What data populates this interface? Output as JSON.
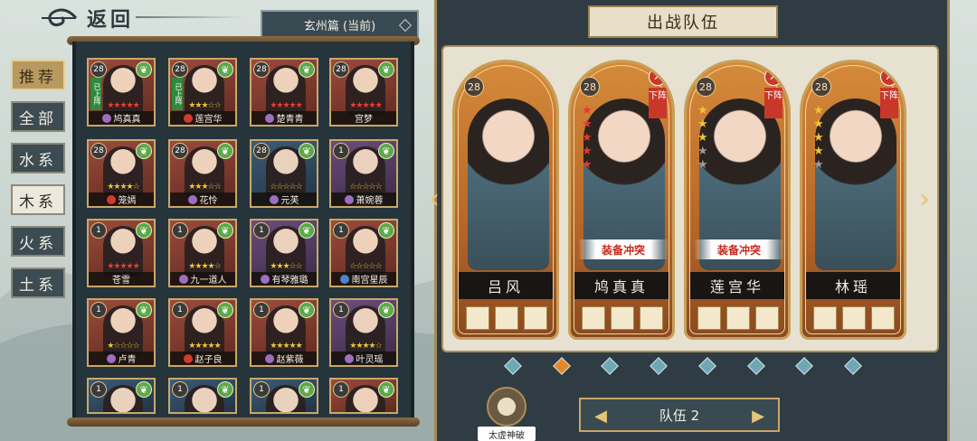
{
  "header": {
    "back_label": "返回",
    "chapter": "玄州篇 (当前)"
  },
  "filters": [
    "推荐",
    "全部",
    "水系",
    "木系",
    "火系",
    "土系"
  ],
  "roster": [
    {
      "name": "鸠真真",
      "level": "28",
      "stars": "★★★★★",
      "star_color": "red",
      "frame": "red",
      "badge": "已上阵",
      "icon": "purple"
    },
    {
      "name": "莲宫华",
      "level": "28",
      "stars": "★★★☆☆",
      "star_color": "gold",
      "frame": "red",
      "badge": "已上阵",
      "icon": "red"
    },
    {
      "name": "楚青青",
      "level": "28",
      "stars": "★★★★★",
      "star_color": "red",
      "frame": "red",
      "badge": "",
      "icon": "purple"
    },
    {
      "name": "宫梦",
      "level": "28",
      "stars": "★★★★★",
      "star_color": "red",
      "frame": "red",
      "badge": "",
      "icon": ""
    },
    {
      "name": "笼嫣",
      "level": "28",
      "stars": "★★★★☆",
      "star_color": "gold",
      "frame": "red",
      "badge": "",
      "icon": "red"
    },
    {
      "name": "花怜",
      "level": "28",
      "stars": "★★★☆☆",
      "star_color": "gold",
      "frame": "red",
      "badge": "",
      "icon": "purple"
    },
    {
      "name": "元芙",
      "level": "28",
      "stars": "☆☆☆☆☆",
      "star_color": "gold",
      "frame": "blue",
      "badge": "",
      "icon": "purple"
    },
    {
      "name": "萧婉蓉",
      "level": "1",
      "stars": "☆☆☆☆☆",
      "star_color": "gold",
      "frame": "purple",
      "badge": "",
      "icon": "purple"
    },
    {
      "name": "苍雪",
      "level": "1",
      "stars": "★★★★★",
      "star_color": "red",
      "frame": "red",
      "badge": "",
      "icon": ""
    },
    {
      "name": "九一道人",
      "level": "1",
      "stars": "★★★★☆",
      "star_color": "gold",
      "frame": "red",
      "badge": "",
      "icon": "purple"
    },
    {
      "name": "有琴雅璐",
      "level": "1",
      "stars": "★★★☆☆",
      "star_color": "gold",
      "frame": "purple",
      "badge": "",
      "icon": "purple"
    },
    {
      "name": "南宫星辰",
      "level": "1",
      "stars": "☆☆☆☆☆",
      "star_color": "gold",
      "frame": "red",
      "badge": "",
      "icon": "blue"
    },
    {
      "name": "卢青",
      "level": "1",
      "stars": "★☆☆☆☆",
      "star_color": "gold",
      "frame": "red",
      "badge": "",
      "icon": "purple"
    },
    {
      "name": "赵子良",
      "level": "1",
      "stars": "★★★★★",
      "star_color": "gold",
      "frame": "red",
      "badge": "",
      "icon": "red"
    },
    {
      "name": "赵紫薇",
      "level": "1",
      "stars": "★★★★★",
      "star_color": "gold",
      "frame": "red",
      "badge": "",
      "icon": "purple"
    },
    {
      "name": "叶灵瑶",
      "level": "1",
      "stars": "★★★★☆",
      "star_color": "gold",
      "frame": "purple",
      "badge": "",
      "icon": "purple"
    },
    {
      "name": "",
      "level": "1",
      "stars": "",
      "star_color": "gold",
      "frame": "blue",
      "badge": "",
      "icon": ""
    },
    {
      "name": "",
      "level": "1",
      "stars": "",
      "star_color": "gold",
      "frame": "blue",
      "badge": "",
      "icon": ""
    },
    {
      "name": "",
      "level": "1",
      "stars": "",
      "star_color": "gold",
      "frame": "blue",
      "badge": "",
      "icon": ""
    },
    {
      "name": "",
      "level": "1",
      "stars": "",
      "star_color": "gold",
      "frame": "red",
      "badge": "",
      "icon": ""
    }
  ],
  "team": {
    "title": "出战队伍",
    "selector": "队伍 2",
    "skill_label": "太虚神破",
    "members": [
      {
        "name": "吕风",
        "level": "28",
        "stars": "",
        "star_color": "gold",
        "conflict": "",
        "removable": false,
        "down_label": "下阵"
      },
      {
        "name": "鸠真真",
        "level": "28",
        "stars": "★★★★★",
        "star_color": "red",
        "conflict": "装备冲突",
        "removable": true,
        "down_label": "下阵"
      },
      {
        "name": "莲宫华",
        "level": "28",
        "stars": "★★★☆☆",
        "star_color": "gold",
        "conflict": "装备冲突",
        "removable": true,
        "down_label": "下阵"
      },
      {
        "name": "林瑶",
        "level": "28",
        "stars": "★★★★☆",
        "star_color": "gold",
        "conflict": "",
        "removable": true,
        "down_label": "下阵"
      }
    ],
    "pages": 8,
    "active_page": 1
  },
  "colors": {
    "accent_gold": "#c9a668",
    "panel_dark": "#2f3c43",
    "leaf_green": "#5da84a",
    "conflict_red": "#c8281e"
  }
}
